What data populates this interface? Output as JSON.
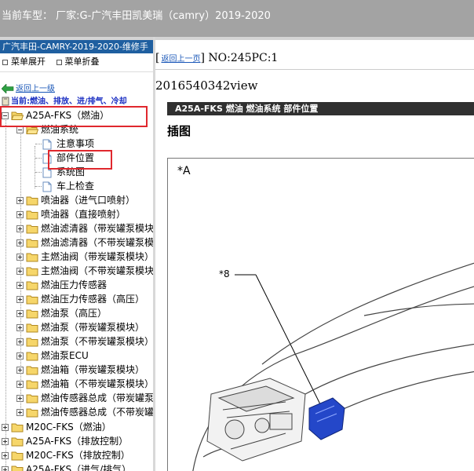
{
  "window": {
    "title": "当前车型： 厂家:G-广汽丰田凯美瑞（camry）2019-2020"
  },
  "left_panel": {
    "title": "广汽丰田-CAMRY-2019-2020-维修手",
    "expand_all": "菜单展开",
    "collapse_all": "菜单折叠",
    "back_link": "返回上一级",
    "current_path": "当前:燃油、排放、进/排气、冷却"
  },
  "tree": {
    "root_group": "A25A-FKS（燃油）",
    "fuel_system": "燃油系统",
    "docs": [
      "注意事项",
      "部件位置",
      "系统图",
      "车上检查"
    ],
    "folders": [
      "喷油器（进气口喷射）",
      "喷油器（直接喷射）",
      "燃油滤清器（带炭罐泵模块）",
      "燃油滤清器（不带炭罐泵模块）",
      "主燃油阀（带炭罐泵模块）",
      "主燃油阀（不带炭罐泵模块）",
      "燃油压力传感器",
      "燃油压力传感器（高压）",
      "燃油泵（高压）",
      "燃油泵（带炭罐泵模块）",
      "燃油泵（不带炭罐泵模块）",
      "燃油泵ECU",
      "燃油箱（带炭罐泵模块）",
      "燃油箱（不带炭罐泵模块）",
      "燃油传感器总成（带炭罐泵模块）",
      "燃油传感器总成（不带炭罐泵模块）"
    ],
    "bottom_groups": [
      "M20C-FKS（燃油）",
      "A25A-FKS（排放控制）",
      "M20C-FKS（排放控制）",
      "A25A-FKS（进气/排气）"
    ]
  },
  "content": {
    "back_link": "返回上一页",
    "doc_id": "NO:245PC:1",
    "view_text": "2016540342view",
    "section_title": "A25A-FKS 燃油  燃油系统  部件位置",
    "subheading": "插图",
    "figure_label": "*A",
    "callout_label": "*8"
  },
  "colors": {
    "top_bar": "#a3a3a3",
    "panel_title": "#1f5fa0",
    "highlight": "#e0282e",
    "link": "#1a57b8",
    "section_bar": "#303030"
  }
}
